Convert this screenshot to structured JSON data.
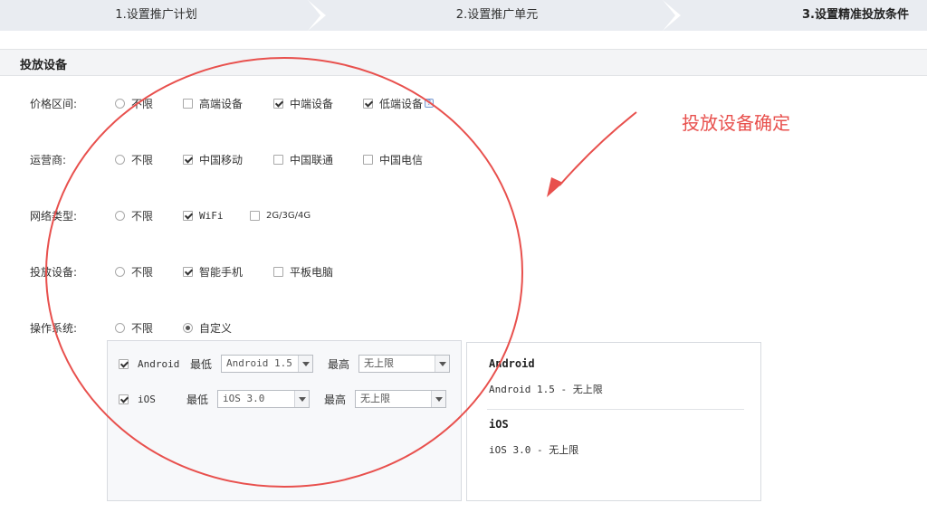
{
  "steps": [
    {
      "label": "1.设置推广计划"
    },
    {
      "label": "2.设置推广单元"
    },
    {
      "label": "3.设置精准投放条件"
    }
  ],
  "section": {
    "title": "投放设备"
  },
  "rows": {
    "price": {
      "label": "价格区间:",
      "options": [
        "不限",
        "高端设备",
        "中端设备",
        "低端设备"
      ],
      "checked": [
        false,
        false,
        true,
        true
      ],
      "help_icon": "question-icon"
    },
    "carrier": {
      "label": "运营商:",
      "options": [
        "不限",
        "中国移动",
        "中国联通",
        "中国电信"
      ],
      "checked": [
        false,
        true,
        false,
        false
      ]
    },
    "network": {
      "label": "网络类型:",
      "options": [
        "不限",
        "WiFi",
        "2G/3G/4G"
      ],
      "checked": [
        false,
        true,
        false
      ]
    },
    "device": {
      "label": "投放设备:",
      "options": [
        "不限",
        "智能手机",
        "平板电脑"
      ],
      "checked": [
        false,
        true,
        false
      ]
    },
    "os": {
      "label": "操作系统:",
      "options": [
        "不限",
        "自定义"
      ],
      "selected": "自定义"
    }
  },
  "os_config": [
    {
      "name": "Android",
      "checked": true,
      "min_label": "最低",
      "min_value": "Android 1.5",
      "max_label": "最高",
      "max_value": "无上限"
    },
    {
      "name": "iOS",
      "checked": true,
      "min_label": "最低",
      "min_value": "iOS 3.0",
      "max_label": "最高",
      "max_value": "无上限"
    }
  ],
  "os_summary": [
    {
      "title": "Android",
      "range": "Android 1.5 - 无上限"
    },
    {
      "title": "iOS",
      "range": "iOS 3.0 - 无上限"
    }
  ],
  "annotation": {
    "text": "投放设备确定",
    "color": "#e8504d"
  }
}
